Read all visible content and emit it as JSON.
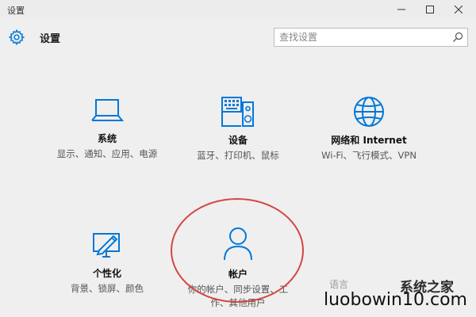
{
  "window": {
    "title": "设置",
    "minimize_icon": "minimize-icon",
    "maximize_icon": "maximize-icon",
    "close_icon": "close-icon"
  },
  "header": {
    "title": "设置",
    "icon": "gear-icon"
  },
  "search": {
    "placeholder": "查找设置",
    "value": "",
    "icon": "search-icon"
  },
  "accent_color": "#0078d7",
  "highlight_color": "#d64541",
  "tiles": [
    {
      "id": "system",
      "label": "系统",
      "desc": "显示、通知、应用、电源",
      "icon": "laptop-icon"
    },
    {
      "id": "devices",
      "label": "设备",
      "desc": "蓝牙、打印机、鼠标",
      "icon": "devices-icon"
    },
    {
      "id": "network",
      "label": "网络和 Internet",
      "desc": "Wi-Fi、飞行模式、VPN",
      "icon": "globe-icon"
    },
    {
      "id": "personalization",
      "label": "个性化",
      "desc": "背景、锁屏、颜色",
      "icon": "personalization-icon"
    },
    {
      "id": "accounts",
      "label": "帐户",
      "desc": "你的帐户、同步设置、工作、其他用户",
      "icon": "person-icon"
    }
  ],
  "watermark": {
    "partial_tile": "语言",
    "logo_text": "系统之家",
    "url": "luobowin10.com"
  }
}
